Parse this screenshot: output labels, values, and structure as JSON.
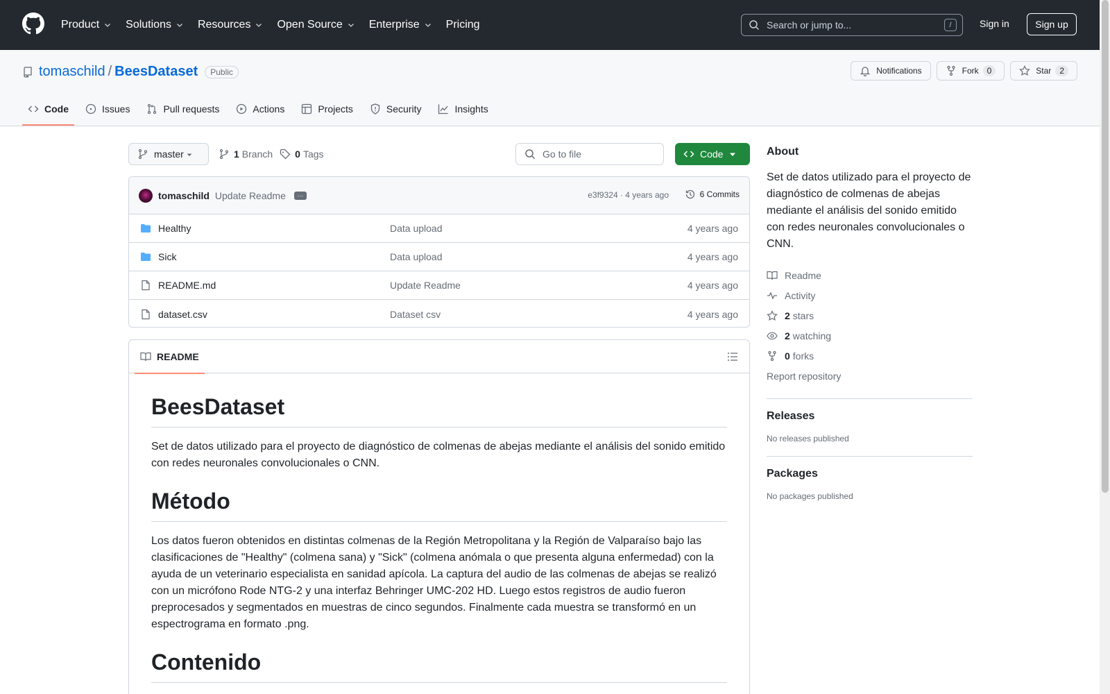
{
  "header": {
    "nav": [
      "Product",
      "Solutions",
      "Resources",
      "Open Source",
      "Enterprise",
      "Pricing"
    ],
    "search_placeholder": "Search or jump to...",
    "search_shortcut": "/",
    "sign_in": "Sign in",
    "sign_up": "Sign up"
  },
  "repo": {
    "owner": "tomaschild",
    "separator": "/",
    "name": "BeesDataset",
    "visibility": "Public",
    "notifications_label": "Notifications",
    "fork_label": "Fork",
    "fork_count": "0",
    "star_label": "Star",
    "star_count": "2",
    "tabs": [
      "Code",
      "Issues",
      "Pull requests",
      "Actions",
      "Projects",
      "Security",
      "Insights"
    ]
  },
  "toolbar": {
    "branch": "master",
    "branch_count": "1",
    "branch_label": "Branch",
    "tag_count": "0",
    "tag_label": "Tags",
    "go_to_file": "Go to file",
    "code_button": "Code"
  },
  "commit": {
    "author": "tomaschild",
    "message": "Update Readme",
    "meta": "e3f9324 · 4 years ago",
    "count": "6 Commits"
  },
  "files": [
    {
      "name": "Healthy",
      "type": "folder",
      "message": "Data upload",
      "date": "4 years ago"
    },
    {
      "name": "Sick",
      "type": "folder",
      "message": "Data upload",
      "date": "4 years ago"
    },
    {
      "name": "README.md",
      "type": "file",
      "message": "Update Readme",
      "date": "4 years ago"
    },
    {
      "name": "dataset.csv",
      "type": "file",
      "message": "Dataset csv",
      "date": "4 years ago"
    }
  ],
  "readme": {
    "tab": "README",
    "title": "BeesDataset",
    "intro": "Set de datos utilizado para el proyecto de diagnóstico de colmenas de abejas mediante el análisis del sonido emitido con redes neuronales convolucionales o CNN.",
    "method_heading": "Método",
    "method_text": "Los datos fueron obtenidos en distintas colmenas de la Región Metropolitana y la Región de Valparaíso bajo las clasificaciones de \"Healthy\" (colmena sana) y \"Sick\" (colmena anómala o que presenta alguna enfermedad) con la ayuda de un veterinario especialista en sanidad apícola. La captura del audio de las colmenas de abejas se realizó con un micrófono Rode NTG-2 y una interfaz Behringer UMC-202 HD. Luego estos registros de audio fueron preprocesados y segmentados en muestras de cinco segundos. Finalmente cada muestra se transformó en un espectrograma en formato .png.",
    "content_heading": "Contenido"
  },
  "sidebar": {
    "about_heading": "About",
    "about_text": "Set de datos utilizado para el proyecto de diagnóstico de colmenas de abejas mediante el análisis del sonido emitido con redes neuronales convolucionales o CNN.",
    "readme": "Readme",
    "activity": "Activity",
    "stars_count": "2",
    "stars_label": "stars",
    "watching_count": "2",
    "watching_label": "watching",
    "forks_count": "0",
    "forks_label": "forks",
    "report": "Report repository",
    "releases_heading": "Releases",
    "releases_text": "No releases published",
    "packages_heading": "Packages",
    "packages_text": "No packages published"
  },
  "colors": {
    "header_bg": "#24292f",
    "link": "#0969da",
    "code_button": "#1f883d",
    "active_tab": "#fd8c73"
  }
}
